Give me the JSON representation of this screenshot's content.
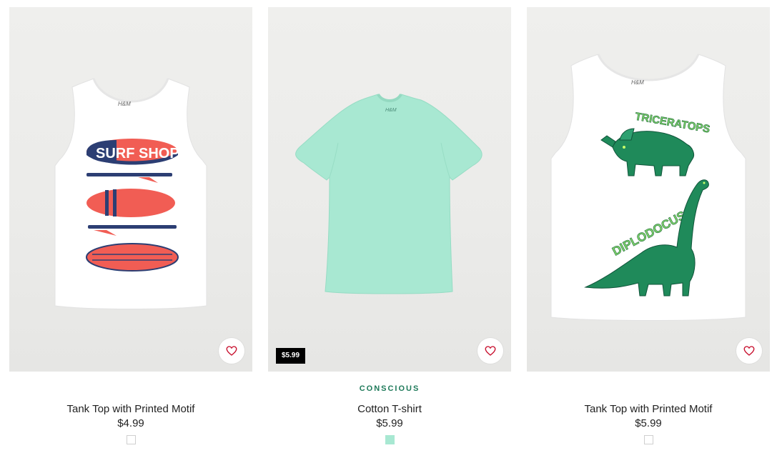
{
  "products": [
    {
      "image_alt": "Tank top with surfboard print",
      "print_text": "SURF SHOP",
      "marker_price": "",
      "badge": "",
      "title": "Tank Top with Printed Motif",
      "price": "$4.99",
      "swatch_color": "#ffffff",
      "favorite_icon": "heart-outline-icon"
    },
    {
      "image_alt": "Mint green cotton t-shirt",
      "marker_price": "$5.99",
      "badge": "CONSCIOUS",
      "title": "Cotton T-shirt",
      "price": "$5.99",
      "swatch_color": "#a8e8d2",
      "favorite_icon": "heart-outline-icon"
    },
    {
      "image_alt": "Tank top with dinosaur print",
      "print_text_1": "TRICERATOPS",
      "print_text_2": "DIPLODOCUS",
      "marker_price": "",
      "badge": "",
      "title": "Tank Top with Printed Motif",
      "price": "$5.99",
      "swatch_color": "#ffffff",
      "favorite_icon": "heart-outline-icon"
    }
  ],
  "colors": {
    "badge_green": "#1f7a5a",
    "heart_red": "#c8102e",
    "price_tag_bg": "#000000"
  }
}
